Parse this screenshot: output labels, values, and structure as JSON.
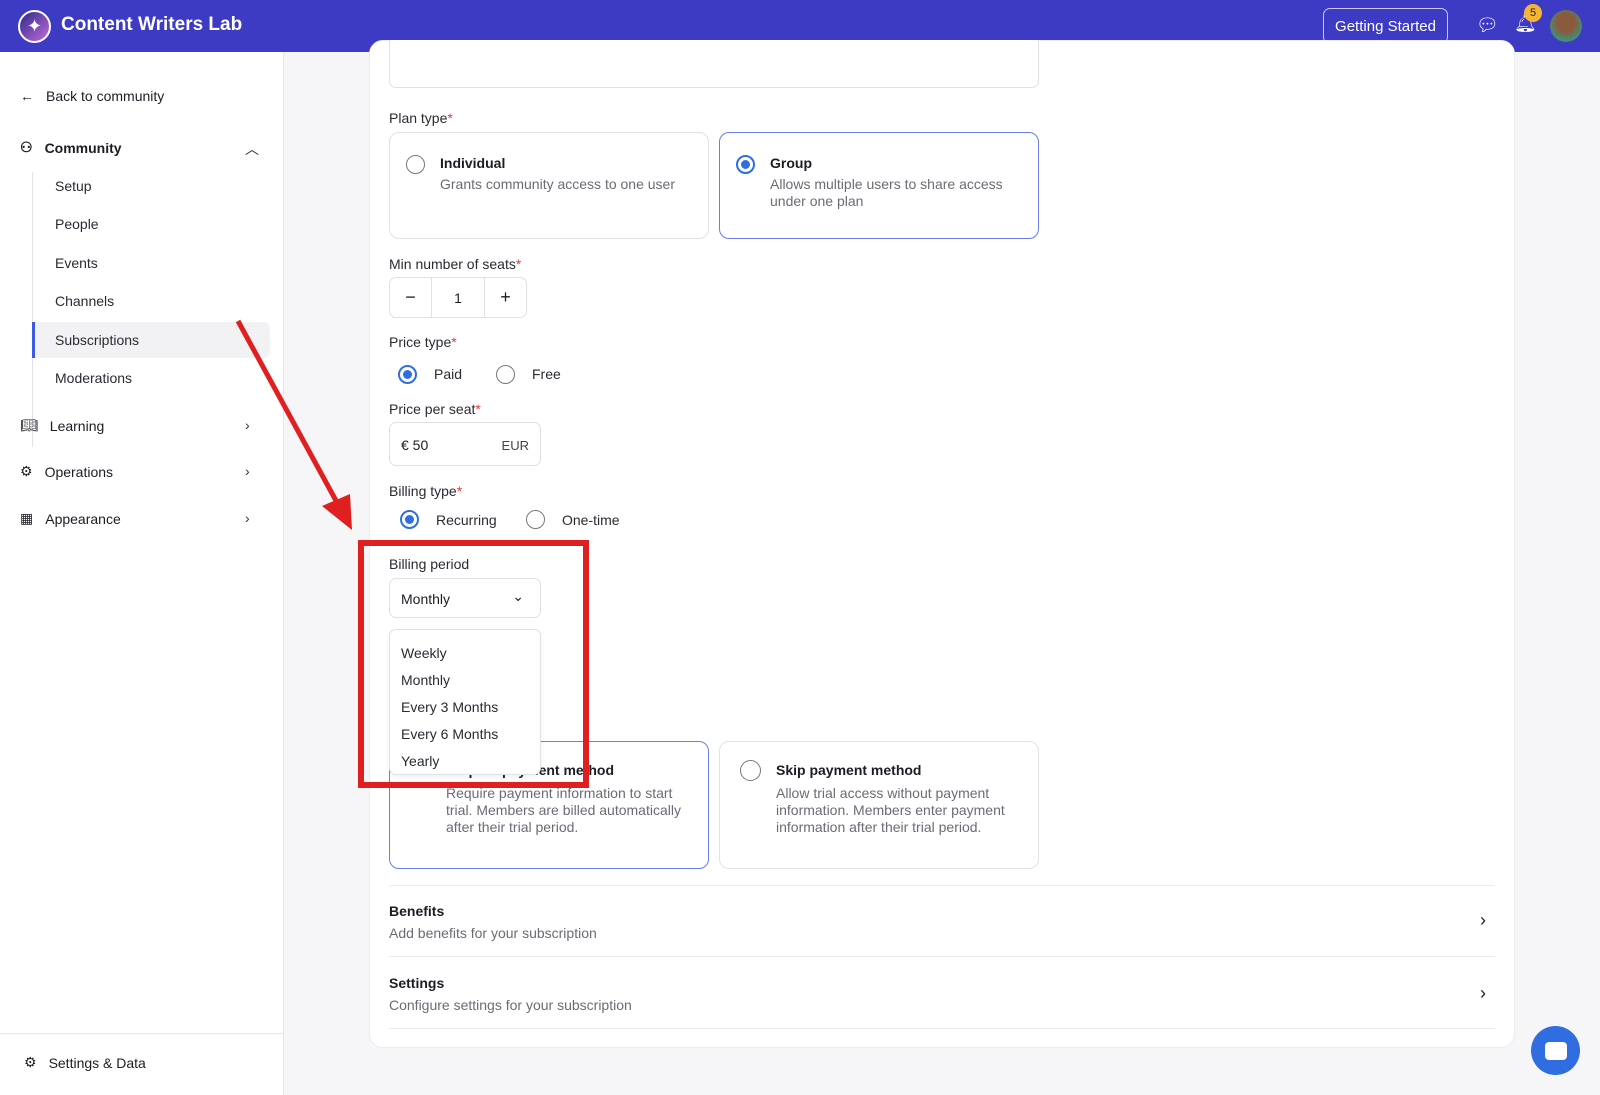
{
  "header": {
    "title": "Content Writers Lab",
    "getting_started": "Getting Started",
    "notification_count": "5"
  },
  "sidebar": {
    "back": "Back to community",
    "community": "Community",
    "sub_items": [
      "Setup",
      "People",
      "Events",
      "Channels",
      "Subscriptions",
      "Moderations"
    ],
    "learning": "Learning",
    "operations": "Operations",
    "appearance": "Appearance",
    "settings": "Settings & Data"
  },
  "form": {
    "plan_type_label": "Plan type",
    "individual_title": "Individual",
    "individual_desc": "Grants community access to one user",
    "group_title": "Group",
    "group_desc": "Allows multiple users to share access under one plan",
    "min_seats_label": "Min number of seats",
    "min_seats_value": "1",
    "price_type_label": "Price type",
    "paid": "Paid",
    "free": "Free",
    "price_per_seat_label": "Price per seat",
    "price_value": "€ 50",
    "currency": "EUR",
    "billing_type_label": "Billing type",
    "recurring": "Recurring",
    "one_time": "One-time",
    "billing_period_label": "Billing period",
    "billing_period_value": "Monthly",
    "billing_period_options": [
      "Weekly",
      "Monthly",
      "Every 3 Months",
      "Every 6 Months",
      "Yearly"
    ],
    "require_title": "Require payment method",
    "require_desc": "Require payment information to start trial. Members are billed automatically after their trial period.",
    "skip_title": "Skip payment method",
    "skip_desc": "Allow trial access without payment information. Members enter payment information after their trial period.",
    "required_mark": "*"
  },
  "sections": {
    "benefits_title": "Benefits",
    "benefits_desc": "Add benefits for your subscription",
    "settings_title": "Settings",
    "settings_desc": "Configure settings for your subscription"
  },
  "colors": {
    "header": "#3d3ac4",
    "accent": "#2f6de1",
    "annotation": "#e02020"
  }
}
